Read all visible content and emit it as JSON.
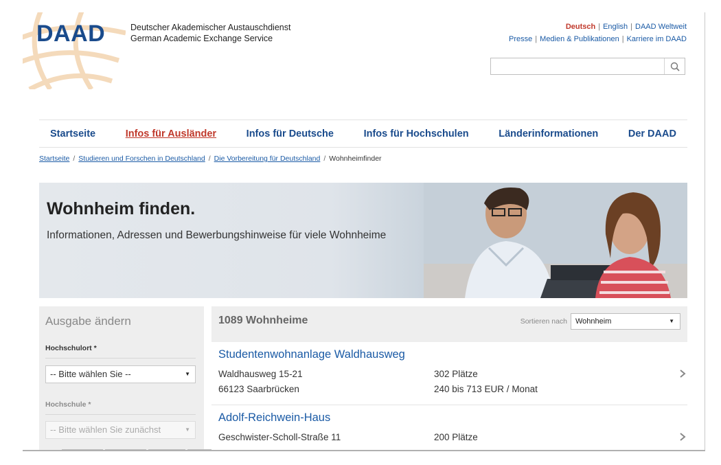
{
  "header": {
    "logo": "DAAD",
    "org_line1": "Deutscher Akademischer Austauschdienst",
    "org_line2": "German Academic Exchange Service",
    "lang_links": [
      "Deutsch",
      "English",
      "DAAD Weltweit"
    ],
    "meta_links": [
      "Presse",
      "Medien & Publikationen",
      "Karriere im DAAD"
    ],
    "search": {
      "value": "",
      "placeholder": ""
    }
  },
  "nav": {
    "items": [
      "Startseite",
      "Infos für Ausländer",
      "Infos für Deutsche",
      "Infos für Hochschulen",
      "Länderinformationen",
      "Der DAAD"
    ],
    "active": "Infos für Ausländer"
  },
  "breadcrumb": {
    "items": [
      "Startseite",
      "Studieren und Forschen in Deutschland",
      "Die Vorbereitung für Deutschland"
    ],
    "current": "Wohnheimfinder"
  },
  "hero": {
    "title": "Wohnheim finden.",
    "subtitle": "Informationen, Adressen und Bewerbungshinweise für viele Wohnheime"
  },
  "sidebar": {
    "title": "Ausgabe ändern",
    "hochschulort_label": "Hochschulort *",
    "hochschulort_value": "-- Bitte wählen Sie --",
    "hochschule_label": "Hochschule *",
    "hochschule_value": "-- Bitte wählen Sie zunächst"
  },
  "results": {
    "count": "1089 Wohnheime",
    "sort_label": "Sortieren nach",
    "sort_value": "Wohnheim",
    "items": [
      {
        "title": "Studentenwohnanlage Waldhausweg",
        "street": "Waldhausweg 15-21",
        "city": "66123 Saarbrücken",
        "places": "302 Plätze",
        "price": "240 bis 713 EUR / Monat"
      },
      {
        "title": "Adolf-Reichwein-Haus",
        "street": "Geschwister-Scholl-Straße 11",
        "city": "",
        "places": "200 Plätze",
        "price": ""
      }
    ]
  },
  "colors": {
    "brand_blue": "#1a4b8c",
    "link_blue": "#1a5aa5",
    "active_red": "#c0392b",
    "panel_grey": "#eeeeee"
  },
  "icons": [
    "globe-logo-icon",
    "search-icon",
    "chevron-right-icon",
    "caret-down-icon"
  ]
}
